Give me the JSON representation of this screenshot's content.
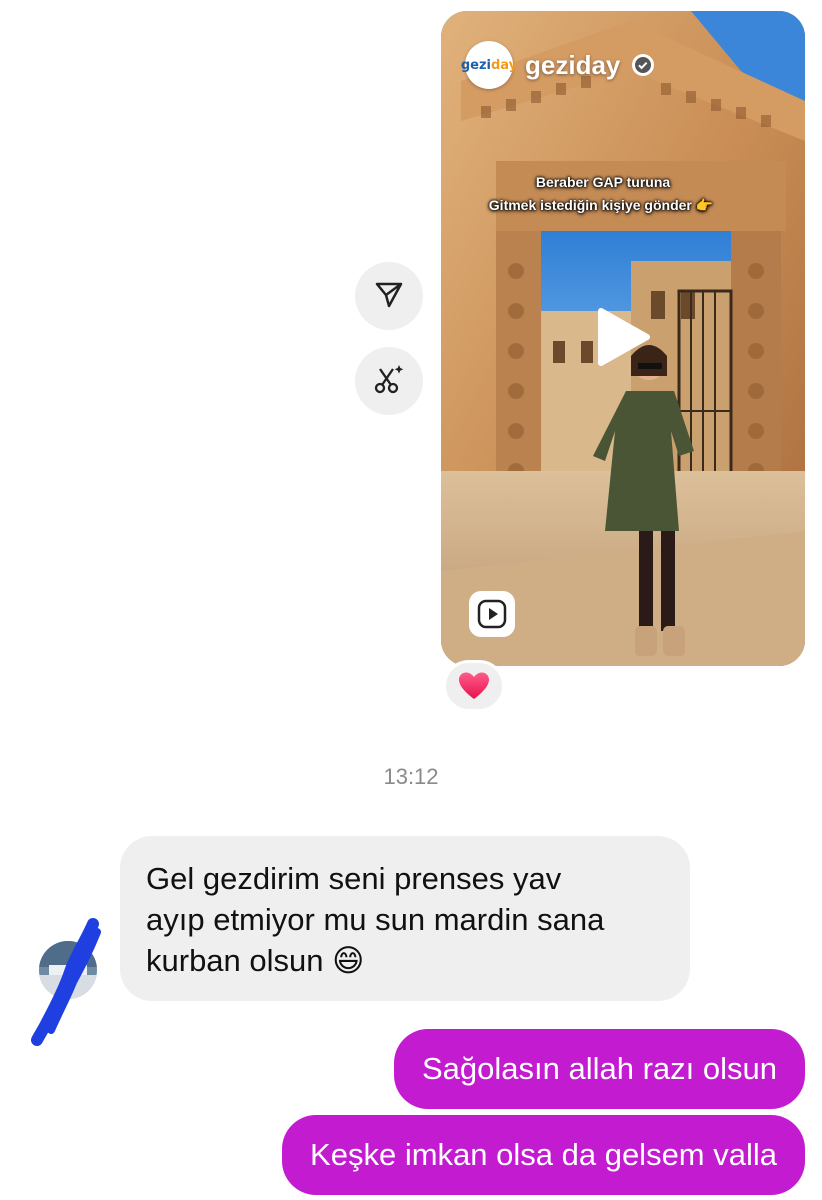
{
  "shared_reel": {
    "account_name": "geziday",
    "logo_text_part1": "gezi",
    "logo_text_part2": "day",
    "caption_line1": "Beraber GAP turuna",
    "caption_line2": "Gitmek istediğin kişiye gönder 👉",
    "verified_icon": "verified-badge-icon",
    "play_icon": "play-icon",
    "reel_icon": "reels-icon"
  },
  "side_actions": [
    {
      "icon": "share-send-icon"
    },
    {
      "icon": "ai-cut-icon"
    }
  ],
  "reaction": {
    "emoji": "❤️"
  },
  "timestamp": "13:12",
  "messages": [
    {
      "direction": "incoming",
      "text_line1": "Gel gezdirim seni prenses yav",
      "text_line2": "ayıp etmiyor mu sun mardin sana",
      "text_line3": "kurban olsun 😄"
    },
    {
      "direction": "outgoing",
      "text": "Sağolasın allah razı olsun"
    },
    {
      "direction": "outgoing",
      "text": "Keşke imkan olsa da gelsem valla"
    }
  ],
  "colors": {
    "outgoing_bubble": "#c21bd0",
    "incoming_bubble": "#efefef",
    "timestamp": "#8a8a8a",
    "redaction_scribble": "#1f3fe0"
  }
}
